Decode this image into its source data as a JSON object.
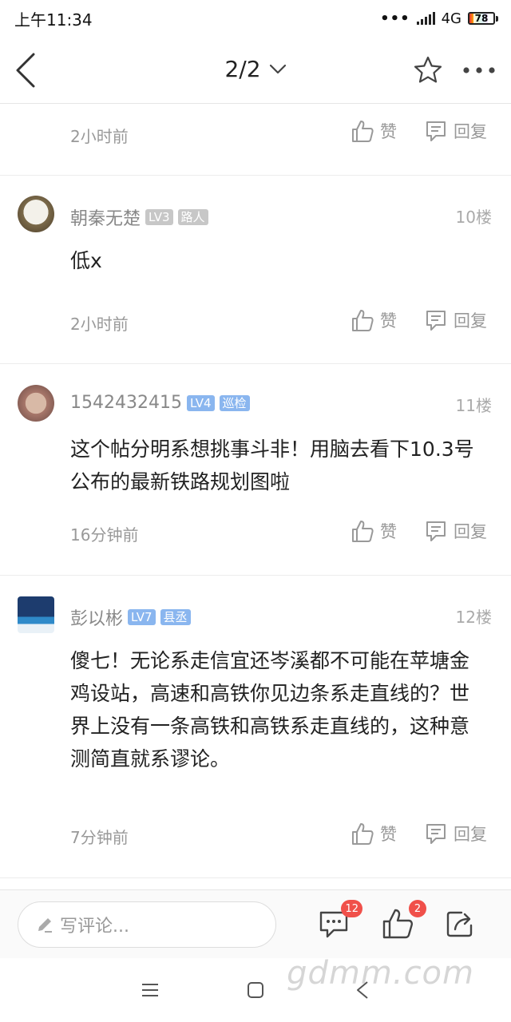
{
  "status_bar": {
    "time": "上午11:34",
    "network": "4G",
    "battery": "78"
  },
  "nav": {
    "page": "2/2"
  },
  "comments": [
    {
      "time": "2小时前",
      "like_label": "赞",
      "reply_label": "回复"
    },
    {
      "username": "朝秦无楚",
      "level": "LV3",
      "title": "路人",
      "floor": "10楼",
      "content": "低x",
      "time": "2小时前",
      "like_label": "赞",
      "reply_label": "回复"
    },
    {
      "username": "1542432415",
      "level": "LV4",
      "title": "巡检",
      "floor": "11楼",
      "content": "这个帖分明系想挑事斗非！用脑去看下10.3号公布的最新铁路规划图啦",
      "time": "16分钟前",
      "like_label": "赞",
      "reply_label": "回复"
    },
    {
      "username": "彭以彬",
      "level": "LV7",
      "title": "县丞",
      "floor": "12楼",
      "content": "傻七！无论系走信宜还岑溪都不可能在苹塘金鸡设站，高速和高铁你见边条系走直线的？世界上没有一条高铁和高铁系走直线的，这种意测简直就系谬论。",
      "time": "7分钟前",
      "like_label": "赞",
      "reply_label": "回复"
    }
  ],
  "bottom_bar": {
    "input_placeholder": "写评论...",
    "comment_count": "12",
    "like_count": "2"
  },
  "watermark": "gdmm.com"
}
